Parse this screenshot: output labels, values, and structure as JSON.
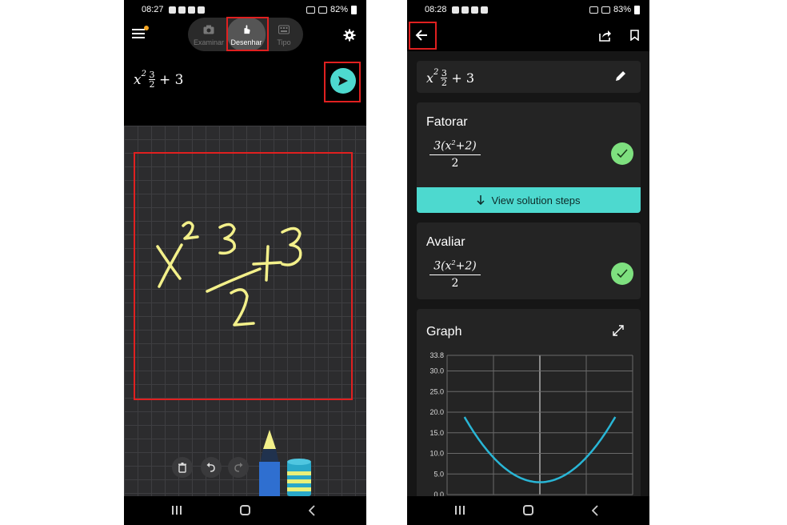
{
  "left_phone": {
    "status": {
      "time": "08:27",
      "battery": "82%"
    },
    "modes": [
      {
        "label": "Examinar",
        "icon": "camera-icon"
      },
      {
        "label": "Desenhar",
        "icon": "hand-draw-icon",
        "selected": true
      },
      {
        "label": "Tipo",
        "icon": "keyboard-icon"
      }
    ],
    "expression": {
      "base": "x",
      "exp": "2",
      "frac_num": "3",
      "frac_den": "2",
      "tail": "+ 3"
    },
    "ink_color": "#f3f08a",
    "accent": "#4dd9cf"
  },
  "right_phone": {
    "status": {
      "time": "08:28",
      "battery": "83%"
    },
    "expression": {
      "base": "x",
      "exp": "2",
      "frac_num": "3",
      "frac_den": "2",
      "tail": "+ 3"
    },
    "fatorar": {
      "title": "Fatorar",
      "result": {
        "num_prefix": "3(x",
        "num_exp": "2",
        "num_suffix": "+2)",
        "den": "2"
      },
      "steps_label": "View solution steps"
    },
    "avaliar": {
      "title": "Avaliar",
      "result": {
        "num_prefix": "3(x",
        "num_exp": "2",
        "num_suffix": "+2)",
        "den": "2"
      }
    },
    "graph": {
      "title": "Graph"
    }
  },
  "chart_data": {
    "type": "line",
    "function": "y = 3(x^2+2)/2",
    "y_ticks": [
      "33.8",
      "30.0",
      "25.0",
      "20.0",
      "15.0",
      "10.0",
      "5.0",
      "0.0"
    ],
    "ylim": [
      0,
      33.8
    ],
    "xlim": [
      -4,
      4
    ],
    "series": [
      {
        "values_x": [
          -3.2,
          -2.8,
          -2.4,
          -2.0,
          -1.6,
          -1.2,
          -0.8,
          -0.4,
          0,
          0.4,
          0.8,
          1.2,
          1.6,
          2.0,
          2.4,
          2.8,
          3.2
        ]
      }
    ],
    "line_color": "#29b6d6",
    "grid": true
  }
}
